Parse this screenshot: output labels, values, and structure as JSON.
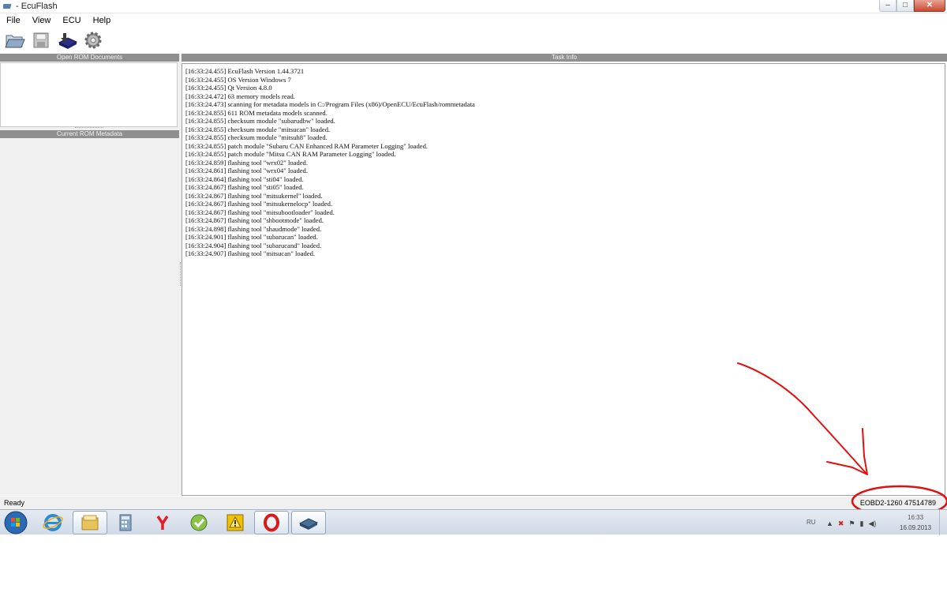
{
  "window": {
    "title": "- EcuFlash",
    "controls": {
      "minimize": "–",
      "maximize": "□",
      "close": "✕"
    }
  },
  "menu": [
    "File",
    "View",
    "ECU",
    "Help"
  ],
  "toolbar": {
    "buttons": [
      "open-folder-icon",
      "save-disk-icon",
      "ecu-chip-icon",
      "settings-gear-icon"
    ]
  },
  "left_panel": {
    "open_docs_title": "Open ROM Documents",
    "metadata_title": "Current ROM Metadata"
  },
  "task_panel": {
    "title": "Task Info",
    "log": [
      "[16:33:24.455] EcuFlash Version 1.44.3721",
      "[16:33:24.455] OS Version Windows 7",
      "[16:33:24.455] Qt Version 4.8.0",
      "[16:33:24.472] 63 memory models read.",
      "[16:33:24.473] scanning for metadata models in C:/Program Files (x86)/OpenECU/EcuFlash/rommetadata",
      "[16:33:24.855] 611 ROM metadata models scanned.",
      "[16:33:24.855] checksum module \"subarudbw\" loaded.",
      "[16:33:24.855] checksum module \"mitsucan\" loaded.",
      "[16:33:24.855] checksum module \"mitsuh8\" loaded.",
      "[16:33:24.855] patch module \"Subaru CAN Enhanced RAM Parameter Logging\" loaded.",
      "[16:33:24.855] patch module \"Mitsu CAN RAM Parameter Logging\" loaded.",
      "[16:33:24.859] flashing tool \"wrx02\" loaded.",
      "[16:33:24.861] flashing tool \"wrx04\" loaded.",
      "[16:33:24.864] flashing tool \"sti04\" loaded.",
      "[16:33:24.867] flashing tool \"sti05\" loaded.",
      "[16:33:24.867] flashing tool \"mitsukernel\" loaded.",
      "[16:33:24.867] flashing tool \"mitsukernelocp\" loaded.",
      "[16:33:24.867] flashing tool \"mitsubootloader\" loaded.",
      "[16:33:24.867] flashing tool \"shbootmode\" loaded.",
      "[16:33:24.898] flashing tool \"shaudmode\" loaded.",
      "[16:33:24.901] flashing tool \"subarucan\" loaded.",
      "[16:33:24.904] flashing tool \"subarucand\" loaded.",
      "[16:33:24.907] flashing tool \"mitsucan\" loaded."
    ]
  },
  "statusbar": {
    "status": "Ready",
    "device": "EOBD2-1260 47514789"
  },
  "annotation": {
    "color": "#e01010"
  },
  "taskbar": {
    "items": [
      "windows-start-icon",
      "internet-explorer-icon",
      "file-explorer-icon",
      "calculator-icon",
      "yandex-browser-icon",
      "green-arrow-app-icon",
      "warning-app-icon",
      "opera-icon",
      "ecuflash-icon"
    ],
    "language": "RU",
    "clock_time": "16:33",
    "clock_date": "16.09.2013"
  }
}
